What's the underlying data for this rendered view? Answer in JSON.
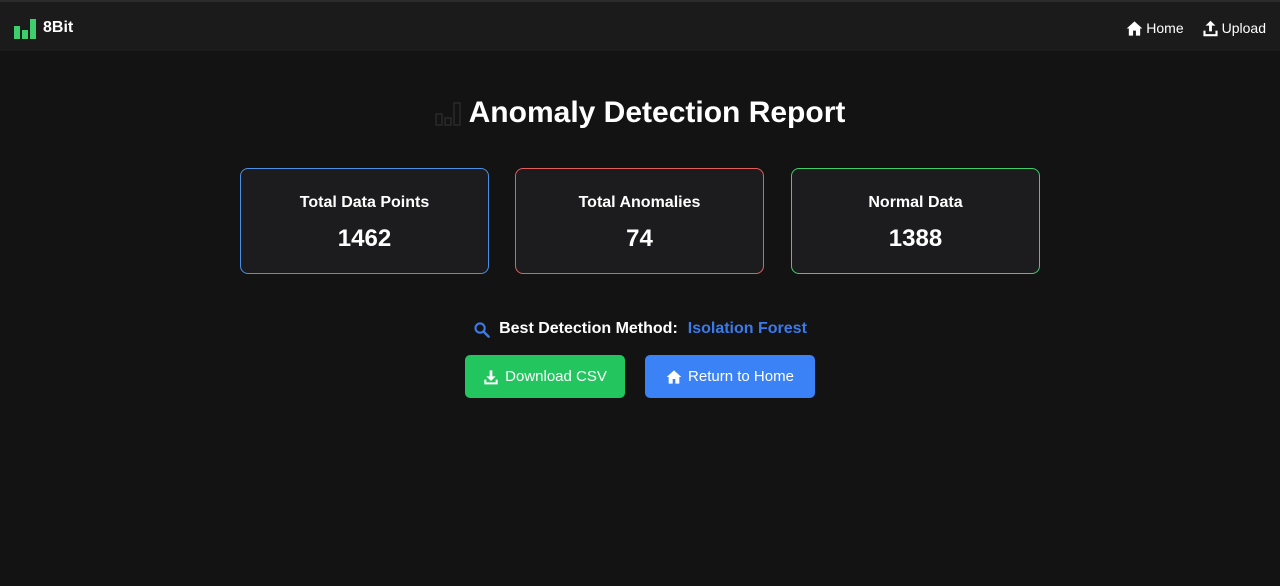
{
  "brand": {
    "name": "8Bit",
    "icon": "bar-chart-icon",
    "color": "#3ecf6c"
  },
  "nav": {
    "items": [
      {
        "label": "Home",
        "icon": "home-icon"
      },
      {
        "label": "Upload",
        "icon": "upload-icon"
      }
    ]
  },
  "page": {
    "title": "Anomaly Detection Report",
    "title_icon": "bar-chart-icon"
  },
  "stats": {
    "total": {
      "label": "Total Data Points",
      "value": "1462",
      "color": "#4b8fe6"
    },
    "anomalies": {
      "label": "Total Anomalies",
      "value": "74",
      "color": "#e45c5c"
    },
    "normal": {
      "label": "Normal Data",
      "value": "1388",
      "color": "#3ecf6c"
    }
  },
  "method": {
    "icon": "search-icon",
    "label": "Best Detection Method:",
    "value": "Isolation Forest",
    "value_color": "#3b7ae8"
  },
  "actions": {
    "download": {
      "label": "Download CSV",
      "icon": "download-icon",
      "color": "#23c55e"
    },
    "home": {
      "label": "Return to Home",
      "icon": "home-icon",
      "color": "#3b82f6"
    }
  }
}
